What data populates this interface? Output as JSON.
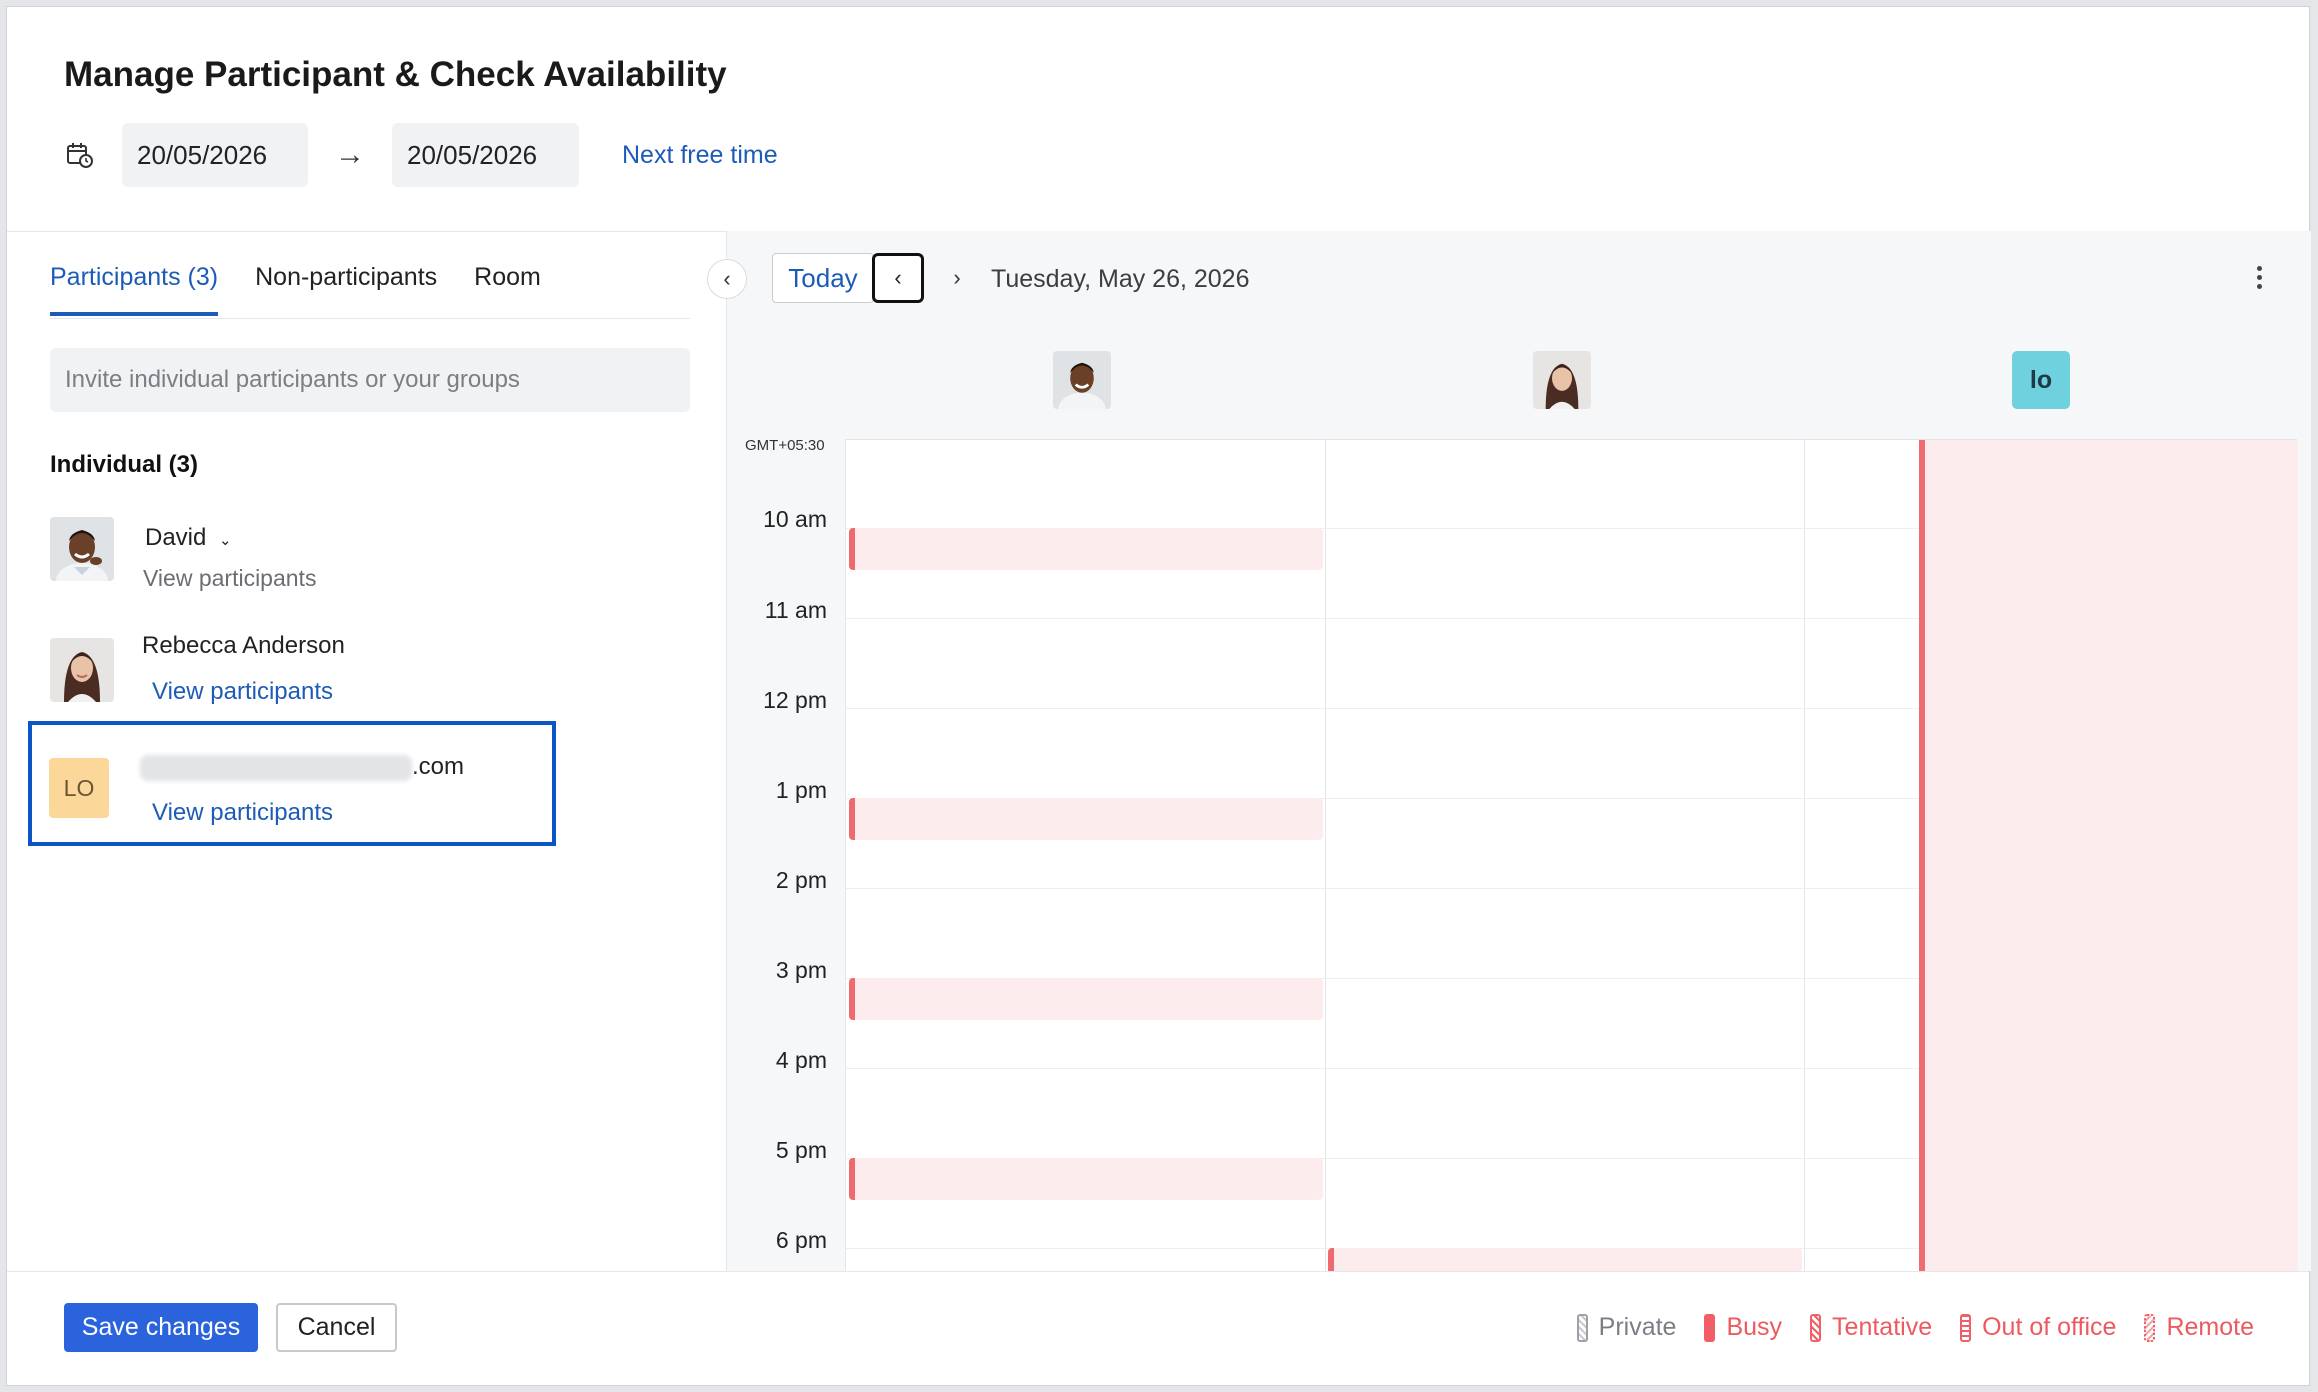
{
  "dialog": {
    "title": "Manage Participant & Check Availability",
    "start_date": "20/05/2026",
    "end_date": "20/05/2026",
    "next_free_time": "Next free time"
  },
  "tabs": [
    {
      "label": "Participants (3)",
      "active": true
    },
    {
      "label": "Non-participants",
      "active": false
    },
    {
      "label": "Room",
      "active": false
    }
  ],
  "invite": {
    "placeholder": "Invite individual participants or your groups"
  },
  "individual": {
    "heading": "Individual (3)",
    "people": [
      {
        "name": "David",
        "link": "View participants",
        "avatar": "man-photo"
      },
      {
        "name": "Rebecca Anderson",
        "link": "View participants",
        "avatar": "woman-photo"
      },
      {
        "name_suffix": ".com",
        "initials": "LO",
        "link": "View participants",
        "avatar_color": "#fbd79a"
      }
    ]
  },
  "calendar": {
    "today_label": "Today",
    "date_label": "Tuesday, May 26, 2026",
    "timezone": "GMT+05:30",
    "third_avatar_initials": "lo",
    "hours": [
      "10 am",
      "11 am",
      "12 pm",
      "1 pm",
      "2 pm",
      "3 pm",
      "4 pm",
      "5 pm",
      "6 pm"
    ],
    "busy_color": "#ee6a6f"
  },
  "footer": {
    "save_label": "Save changes",
    "cancel_label": "Cancel",
    "legend": [
      "Private",
      "Busy",
      "Tentative",
      "Out of office",
      "Remote"
    ]
  }
}
